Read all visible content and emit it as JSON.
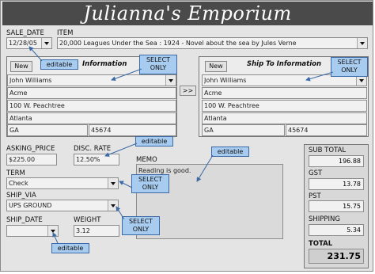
{
  "app": {
    "title": "Julianna's Emporium"
  },
  "sale_date": {
    "label": "SALE_DATE",
    "value": "12/28/05"
  },
  "item": {
    "label": "ITEM",
    "value": "20,000 Leagues Under the Sea : 1924 - Novel about the sea by Jules Verne"
  },
  "bill_to": {
    "new_label": "New",
    "title": "Information",
    "customer": "John Williams",
    "company": "Acme",
    "address": "100 W. Peachtree",
    "city": "Atlanta",
    "state": "GA",
    "zip": "45674"
  },
  "copy_button": {
    "label": ">>"
  },
  "ship_to": {
    "new_label": "New",
    "title": "Ship To Information",
    "customer": "John Williams",
    "company": "Acme",
    "address": "100 W. Peachtree",
    "city": "Atlanta",
    "state": "GA",
    "zip": "45674"
  },
  "asking_price": {
    "label": "ASKING_PRICE",
    "value": "$225.00"
  },
  "disc_rate": {
    "label": "DISC. RATE",
    "value": "12.50%"
  },
  "term": {
    "label": "TERM",
    "value": "Check"
  },
  "ship_via": {
    "label": "SHIP_VIA",
    "value": "UPS GROUND"
  },
  "ship_date": {
    "label": "SHIP_DATE",
    "value": ""
  },
  "weight": {
    "label": "WEIGHT",
    "value": "3.12"
  },
  "memo": {
    "label": "MEMO",
    "value": "Reading is good."
  },
  "summary": {
    "subtotal_label": "SUB TOTAL",
    "subtotal": "196.88",
    "gst_label": "GST",
    "gst": "13.78",
    "pst_label": "PST",
    "pst": "15.75",
    "shipping_label": "SHIPPING",
    "shipping": "5.34",
    "total_label": "TOTAL",
    "total": "231.75"
  },
  "callouts": {
    "editable": "editable",
    "select_only_1": "SELECT",
    "select_only_2": "ONLY"
  },
  "colors": {
    "title_bar": "#4a4a4a",
    "callout_fill": "#a8ccf0",
    "callout_border": "#3b6aa6"
  }
}
